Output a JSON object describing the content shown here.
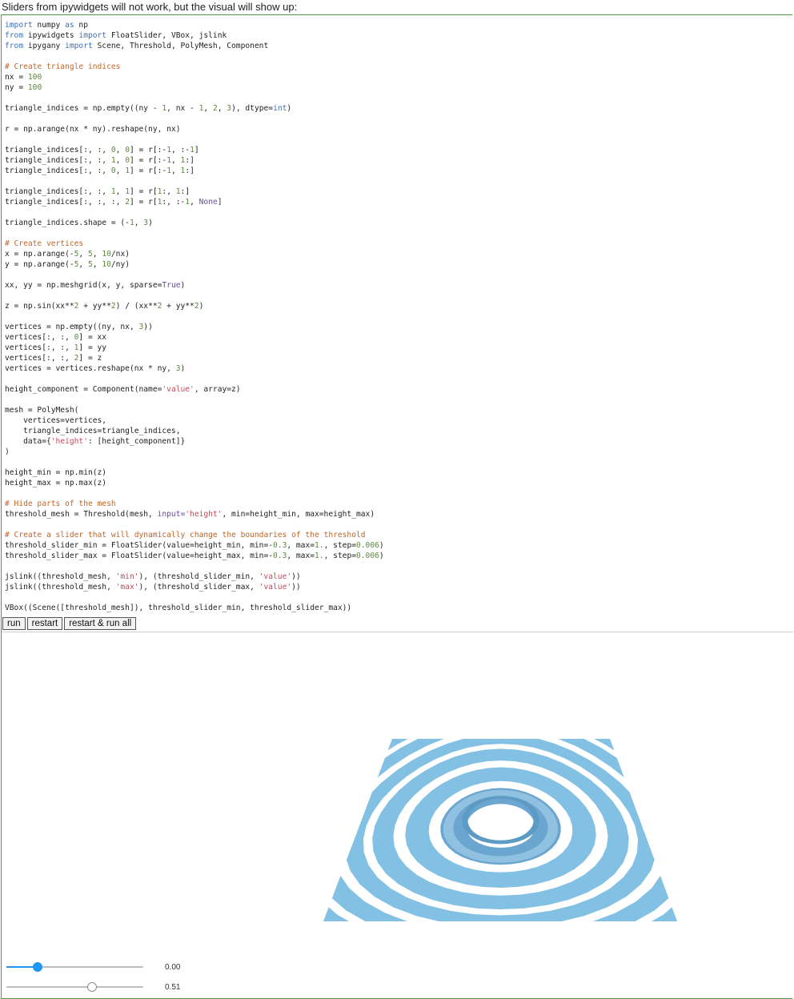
{
  "intro_text": "Sliders from ipywidgets will not work, but the visual will show up:",
  "code_lines": [
    [
      [
        "import",
        "kw"
      ],
      [
        " numpy ",
        ""
      ],
      [
        "as",
        "kw"
      ],
      [
        " np",
        ""
      ]
    ],
    [
      [
        "from",
        "kw"
      ],
      [
        " ipywidgets ",
        ""
      ],
      [
        "import",
        "kw"
      ],
      [
        " FloatSlider, VBox, jslink",
        ""
      ]
    ],
    [
      [
        "from",
        "kw"
      ],
      [
        " ipygany ",
        ""
      ],
      [
        "import",
        "kw"
      ],
      [
        " Scene, Threshold, PolyMesh, Component",
        ""
      ]
    ],
    [],
    [
      [
        "# Create triangle indices",
        "c"
      ]
    ],
    [
      [
        "nx = ",
        ""
      ],
      [
        "100",
        "n"
      ]
    ],
    [
      [
        "ny = ",
        ""
      ],
      [
        "100",
        "n"
      ]
    ],
    [],
    [
      [
        "triangle_indices = np.empty((ny - ",
        ""
      ],
      [
        "1",
        "n"
      ],
      [
        ", nx - ",
        ""
      ],
      [
        "1",
        "n"
      ],
      [
        ", ",
        ""
      ],
      [
        "2",
        "n"
      ],
      [
        ", ",
        ""
      ],
      [
        "3",
        "n"
      ],
      [
        "), dtype=",
        ""
      ],
      [
        "int",
        "kw"
      ],
      [
        ")",
        ""
      ]
    ],
    [],
    [
      [
        "r = np.arange(nx * ny).reshape(ny, nx)",
        ""
      ]
    ],
    [],
    [
      [
        "triangle_indices[:, :, ",
        ""
      ],
      [
        "0",
        "n"
      ],
      [
        ", ",
        ""
      ],
      [
        "0",
        "n"
      ],
      [
        "] = r[:-",
        ""
      ],
      [
        "1",
        "n"
      ],
      [
        ", :-",
        ""
      ],
      [
        "1",
        "n"
      ],
      [
        "]",
        ""
      ]
    ],
    [
      [
        "triangle_indices[:, :, ",
        ""
      ],
      [
        "1",
        "n"
      ],
      [
        ", ",
        ""
      ],
      [
        "0",
        "n"
      ],
      [
        "] = r[:-",
        ""
      ],
      [
        "1",
        "n"
      ],
      [
        ", ",
        ""
      ],
      [
        "1",
        "n"
      ],
      [
        ":]",
        ""
      ]
    ],
    [
      [
        "triangle_indices[:, :, ",
        ""
      ],
      [
        "0",
        "n"
      ],
      [
        ", ",
        ""
      ],
      [
        "1",
        "n"
      ],
      [
        "] = r[:-",
        ""
      ],
      [
        "1",
        "n"
      ],
      [
        ", ",
        ""
      ],
      [
        "1",
        "n"
      ],
      [
        ":]",
        ""
      ]
    ],
    [],
    [
      [
        "triangle_indices[:, :, ",
        ""
      ],
      [
        "1",
        "n"
      ],
      [
        ", ",
        ""
      ],
      [
        "1",
        "n"
      ],
      [
        "] = r[",
        ""
      ],
      [
        "1",
        "n"
      ],
      [
        ":, ",
        ""
      ],
      [
        "1",
        "n"
      ],
      [
        ":]",
        ""
      ]
    ],
    [
      [
        "triangle_indices[:, :, :, ",
        ""
      ],
      [
        "2",
        "n"
      ],
      [
        "] = r[",
        ""
      ],
      [
        "1",
        "n"
      ],
      [
        ":, :-",
        ""
      ],
      [
        "1",
        "n"
      ],
      [
        ", ",
        ""
      ],
      [
        "None",
        "k"
      ],
      [
        "]",
        ""
      ]
    ],
    [],
    [
      [
        "triangle_indices.shape = (-",
        ""
      ],
      [
        "1",
        "n"
      ],
      [
        ", ",
        ""
      ],
      [
        "3",
        "n"
      ],
      [
        ")",
        ""
      ]
    ],
    [],
    [
      [
        "# Create vertices",
        "c"
      ]
    ],
    [
      [
        "x = np.arange(-",
        ""
      ],
      [
        "5",
        "n"
      ],
      [
        ", ",
        ""
      ],
      [
        "5",
        "n"
      ],
      [
        ", ",
        ""
      ],
      [
        "10",
        "n"
      ],
      [
        "/nx)",
        ""
      ]
    ],
    [
      [
        "y = np.arange(-",
        ""
      ],
      [
        "5",
        "n"
      ],
      [
        ", ",
        ""
      ],
      [
        "5",
        "n"
      ],
      [
        ", ",
        ""
      ],
      [
        "10",
        "n"
      ],
      [
        "/ny)",
        ""
      ]
    ],
    [],
    [
      [
        "xx, yy = np.meshgrid(x, y, sparse=",
        ""
      ],
      [
        "True",
        "k"
      ],
      [
        ")",
        ""
      ]
    ],
    [],
    [
      [
        "z = np.sin(xx**",
        ""
      ],
      [
        "2",
        "n"
      ],
      [
        " + yy**",
        ""
      ],
      [
        "2",
        "n"
      ],
      [
        ") / (xx**",
        ""
      ],
      [
        "2",
        "n"
      ],
      [
        " + yy**",
        ""
      ],
      [
        "2",
        "n"
      ],
      [
        ")",
        ""
      ]
    ],
    [],
    [
      [
        "vertices = np.empty((ny, nx, ",
        ""
      ],
      [
        "3",
        "n"
      ],
      [
        "))",
        ""
      ]
    ],
    [
      [
        "vertices[:, :, ",
        ""
      ],
      [
        "0",
        "n"
      ],
      [
        "] = xx",
        ""
      ]
    ],
    [
      [
        "vertices[:, :, ",
        ""
      ],
      [
        "1",
        "n"
      ],
      [
        "] = yy",
        ""
      ]
    ],
    [
      [
        "vertices[:, :, ",
        ""
      ],
      [
        "2",
        "n"
      ],
      [
        "] = z",
        ""
      ]
    ],
    [
      [
        "vertices = vertices.reshape(nx * ny, ",
        ""
      ],
      [
        "3",
        "n"
      ],
      [
        ")",
        ""
      ]
    ],
    [],
    [
      [
        "height_component = Component(name=",
        ""
      ],
      [
        "'value'",
        "s"
      ],
      [
        ", array=z)",
        ""
      ]
    ],
    [],
    [
      [
        "mesh = PolyMesh(",
        ""
      ]
    ],
    [
      [
        "    vertices=vertices,",
        ""
      ]
    ],
    [
      [
        "    triangle_indices=triangle_indices,",
        ""
      ]
    ],
    [
      [
        "    data={",
        ""
      ],
      [
        "'height'",
        "s"
      ],
      [
        ": [height_component]}",
        ""
      ]
    ],
    [
      [
        ")",
        ""
      ]
    ],
    [],
    [
      [
        "height_min = np.min(z)",
        ""
      ]
    ],
    [
      [
        "height_max = np.max(z)",
        ""
      ]
    ],
    [],
    [
      [
        "# Hide parts of the mesh",
        "c"
      ]
    ],
    [
      [
        "threshold_mesh = Threshold(mesh, ",
        ""
      ],
      [
        "input=",
        "k"
      ],
      [
        "'height'",
        "s"
      ],
      [
        ", min=height_min, max=height_max)",
        ""
      ]
    ],
    [],
    [
      [
        "# Create a slider that will dynamically change the boundaries of the threshold",
        "c"
      ]
    ],
    [
      [
        "threshold_slider_min = FloatSlider(value=height_min, min=-",
        ""
      ],
      [
        "0.3",
        "n"
      ],
      [
        ", max=",
        ""
      ],
      [
        "1.",
        "n"
      ],
      [
        ", step=",
        ""
      ],
      [
        "0.006",
        "n"
      ],
      [
        ")",
        ""
      ]
    ],
    [
      [
        "threshold_slider_max = FloatSlider(value=height_max, min=-",
        ""
      ],
      [
        "0.3",
        "n"
      ],
      [
        ", max=",
        ""
      ],
      [
        "1.",
        "n"
      ],
      [
        ", step=",
        ""
      ],
      [
        "0.006",
        "n"
      ],
      [
        ")",
        ""
      ]
    ],
    [],
    [
      [
        "jslink((threshold_mesh, ",
        ""
      ],
      [
        "'min'",
        "s"
      ],
      [
        "), (threshold_slider_min, ",
        ""
      ],
      [
        "'value'",
        "s"
      ],
      [
        "))",
        ""
      ]
    ],
    [
      [
        "jslink((threshold_mesh, ",
        ""
      ],
      [
        "'max'",
        "s"
      ],
      [
        "), (threshold_slider_max, ",
        ""
      ],
      [
        "'value'",
        "s"
      ],
      [
        "))",
        ""
      ]
    ],
    [],
    [
      [
        "VBox((Scene([threshold_mesh]), threshold_slider_min, threshold_slider_max))",
        ""
      ]
    ]
  ],
  "buttons": {
    "run": "run",
    "restart": "restart",
    "restart_run_all": "restart & run all"
  },
  "scene": {
    "ring_color": "#82c0e4",
    "inner_color": "#6aa6cf",
    "inner_light": "#aed7ef"
  },
  "sliders": {
    "min": {
      "min": -0.3,
      "max": 1.0,
      "value": 0.0,
      "readout": "0.00"
    },
    "max": {
      "min": -0.3,
      "max": 1.0,
      "value": 0.51,
      "readout": "0.51"
    }
  }
}
